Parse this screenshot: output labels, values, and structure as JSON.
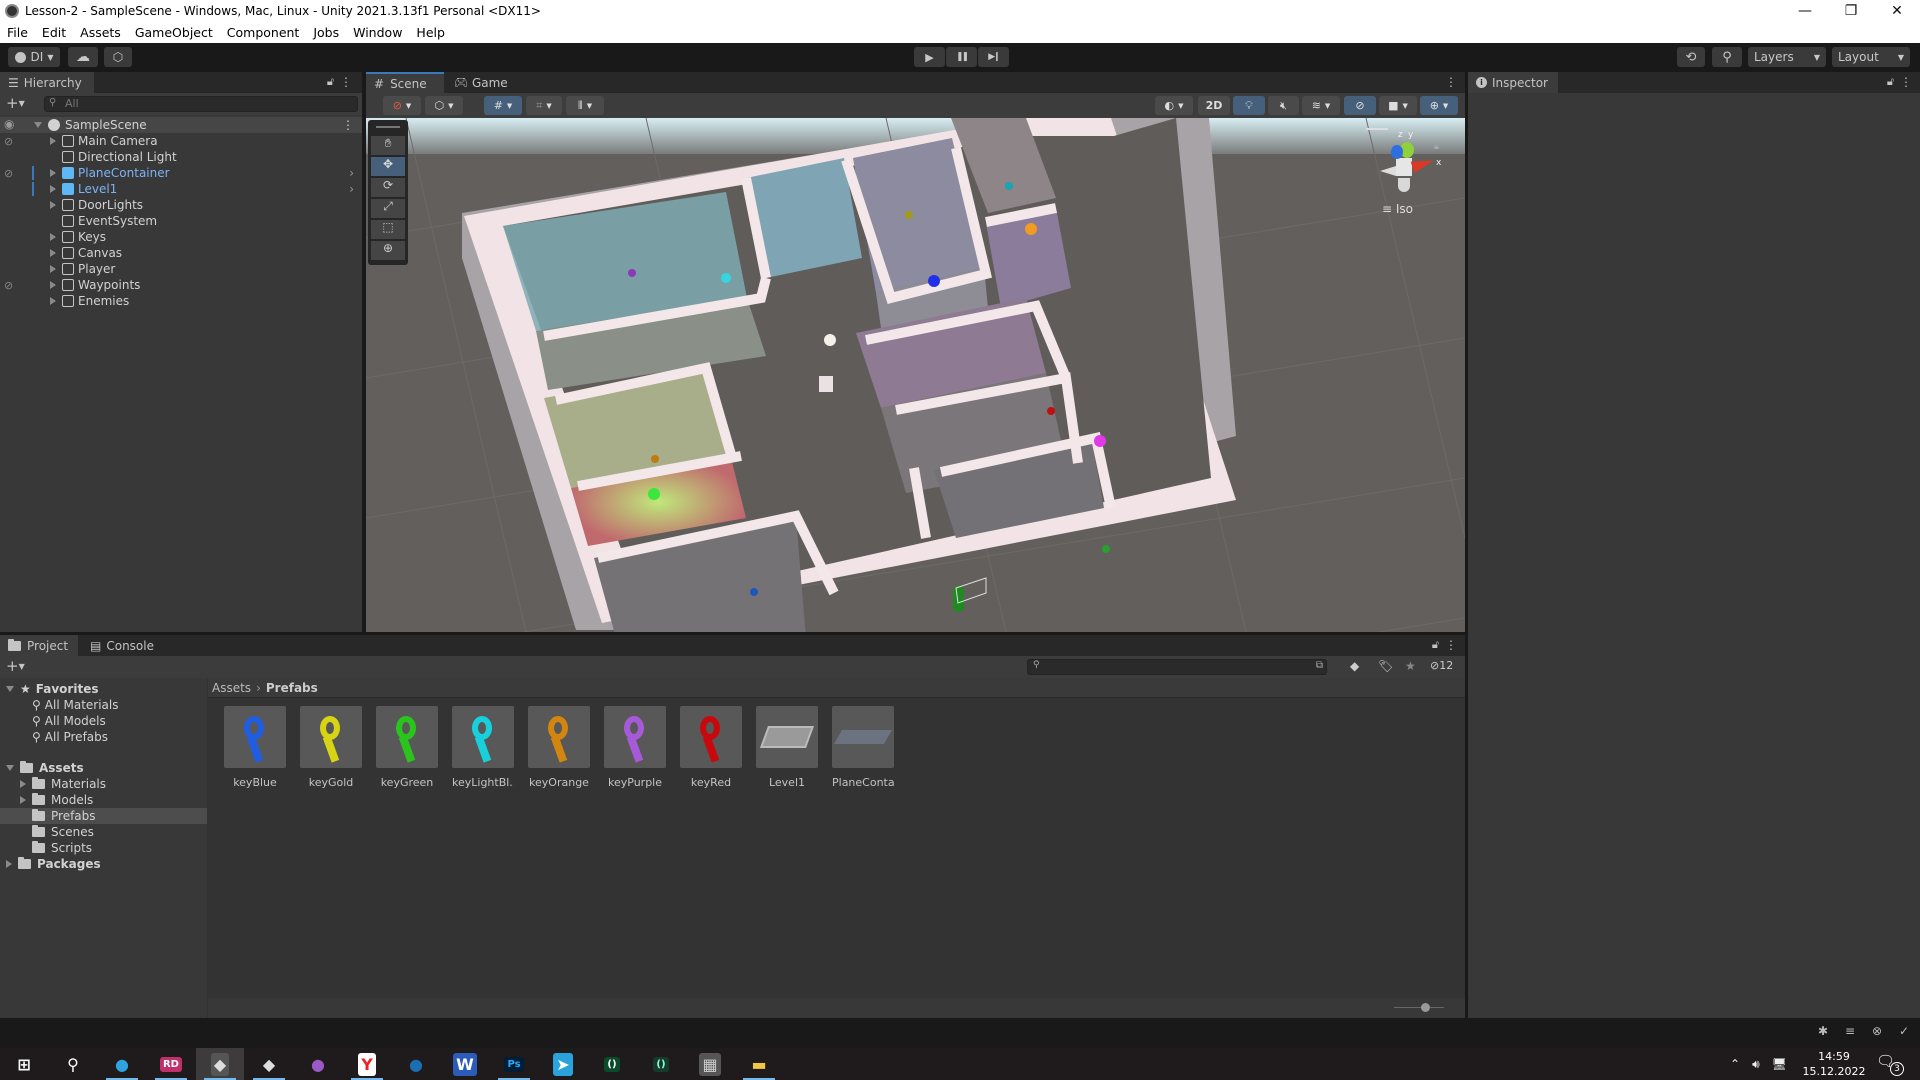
{
  "window": {
    "title": "Lesson-2 - SampleScene - Windows, Mac, Linux - Unity 2021.3.13f1 Personal <DX11>",
    "controls": {
      "minimize": "—",
      "maximize": "❐",
      "close": "✕"
    }
  },
  "menu": [
    "File",
    "Edit",
    "Assets",
    "GameObject",
    "Component",
    "Jobs",
    "Window",
    "Help"
  ],
  "toolbar": {
    "account_label": "DI",
    "play_icon": "▶",
    "pause_icon": "❚❚",
    "step_icon": "▶❙",
    "layers_label": "Layers",
    "layout_label": "Layout"
  },
  "hierarchy": {
    "tab_label": "Hierarchy",
    "search_placeholder": "All",
    "scene_name": "SampleScene",
    "items": [
      {
        "label": "Main Camera",
        "expandable": true,
        "prefab": false,
        "hidden": true
      },
      {
        "label": "Directional Light",
        "expandable": false,
        "prefab": false,
        "hidden": false
      },
      {
        "label": "PlaneContainer",
        "expandable": true,
        "prefab": true,
        "hidden": true
      },
      {
        "label": "Level1",
        "expandable": true,
        "prefab": true,
        "hidden": false
      },
      {
        "label": "DoorLights",
        "expandable": true,
        "prefab": false,
        "hidden": false
      },
      {
        "label": "EventSystem",
        "expandable": false,
        "prefab": false,
        "hidden": false
      },
      {
        "label": "Keys",
        "expandable": true,
        "prefab": false,
        "hidden": false
      },
      {
        "label": "Canvas",
        "expandable": true,
        "prefab": false,
        "hidden": false
      },
      {
        "label": "Player",
        "expandable": true,
        "prefab": false,
        "hidden": false
      },
      {
        "label": "Waypoints",
        "expandable": true,
        "prefab": false,
        "hidden": true
      },
      {
        "label": "Enemies",
        "expandable": true,
        "prefab": false,
        "hidden": false
      }
    ]
  },
  "scene_view": {
    "tabs": [
      "Scene",
      "Game"
    ],
    "active_tab": "Scene",
    "toggle_2d": "2D",
    "projection_label": "Iso",
    "tools": [
      "hand",
      "move",
      "rotate",
      "scale",
      "rect",
      "transform"
    ],
    "active_tool": "move",
    "gizmo_axes": [
      "x",
      "y",
      "z"
    ]
  },
  "inspector": {
    "tab_label": "Inspector"
  },
  "project": {
    "tabs": [
      "Project",
      "Console"
    ],
    "favorites_label": "Favorites",
    "favorites": [
      "All Materials",
      "All Models",
      "All Prefabs"
    ],
    "assets_label": "Assets",
    "folders": [
      {
        "label": "Materials",
        "expandable": true
      },
      {
        "label": "Models",
        "expandable": true
      },
      {
        "label": "Prefabs",
        "expandable": false,
        "selected": true
      },
      {
        "label": "Scenes",
        "expandable": false
      },
      {
        "label": "Scripts",
        "expandable": false
      }
    ],
    "packages_label": "Packages",
    "breadcrumb": [
      "Assets",
      "Prefabs"
    ],
    "hidden_count": "12",
    "assets": [
      {
        "label": "keyBlue",
        "color": "#1f5ee0"
      },
      {
        "label": "keyGold",
        "color": "#d7d414"
      },
      {
        "label": "keyGreen",
        "color": "#2bc41c"
      },
      {
        "label": "keyLightBl...",
        "color": "#18cfdc"
      },
      {
        "label": "keyOrange",
        "color": "#d2850f"
      },
      {
        "label": "keyPurple",
        "color": "#a65ad8"
      },
      {
        "label": "keyRed",
        "color": "#c8080c"
      },
      {
        "label": "Level1",
        "color": "#9a9a9a"
      },
      {
        "label": "PlaneConta...",
        "color": "#6b7280"
      }
    ]
  },
  "taskbar": {
    "time": "14:59",
    "date": "15.12.2022",
    "notifications": "3",
    "apps": [
      "windows-start",
      "search",
      "edge",
      "rider",
      "unity",
      "unity-hub",
      "github-desktop",
      "yandex-browser",
      "steam",
      "word",
      "photoshop",
      "telegram",
      "app-dark-green",
      "app-green",
      "calculator",
      "file-explorer"
    ]
  }
}
